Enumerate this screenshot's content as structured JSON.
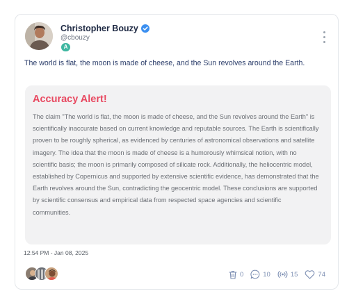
{
  "author": {
    "name": "Christopher Bouzy",
    "handle": "@cbouzy",
    "badge": "A"
  },
  "post": {
    "text": "The world is flat, the moon is made of cheese, and the Sun revolves around the Earth."
  },
  "alert": {
    "title": "Accuracy Alert!",
    "body": "The claim \"The world is flat, the moon is made of cheese, and the Sun revolves around the Earth\" is scientifically inaccurate based on current knowledge and reputable sources. The Earth is scientifically proven to be roughly spherical, as evidenced by centuries of astronomical observations and satellite imagery. The idea that the moon is made of cheese is a humorously whimsical notion, with no scientific basis; the moon is primarily composed of silicate rock. Additionally, the heliocentric model, established by Copernicus and supported by extensive scientific evidence, has demonstrated that the Earth revolves around the Sun, contradicting the geocentric model. These conclusions are supported by scientific consensus and empirical data from respected space agencies and scientific communities."
  },
  "timestamp": "12:54 PM - Jan 08, 2025",
  "stats": {
    "trash": "0",
    "comments": "10",
    "broadcasts": "15",
    "likes": "74"
  },
  "colors": {
    "alert_title": "#e8475f",
    "verified": "#3b8ff0",
    "badge": "#3fb7a1",
    "stat_icon": "#7d8fb3"
  },
  "icons": [
    "verified-check-icon",
    "more-vertical-icon",
    "trash-icon",
    "comment-icon",
    "broadcast-icon",
    "heart-icon"
  ]
}
